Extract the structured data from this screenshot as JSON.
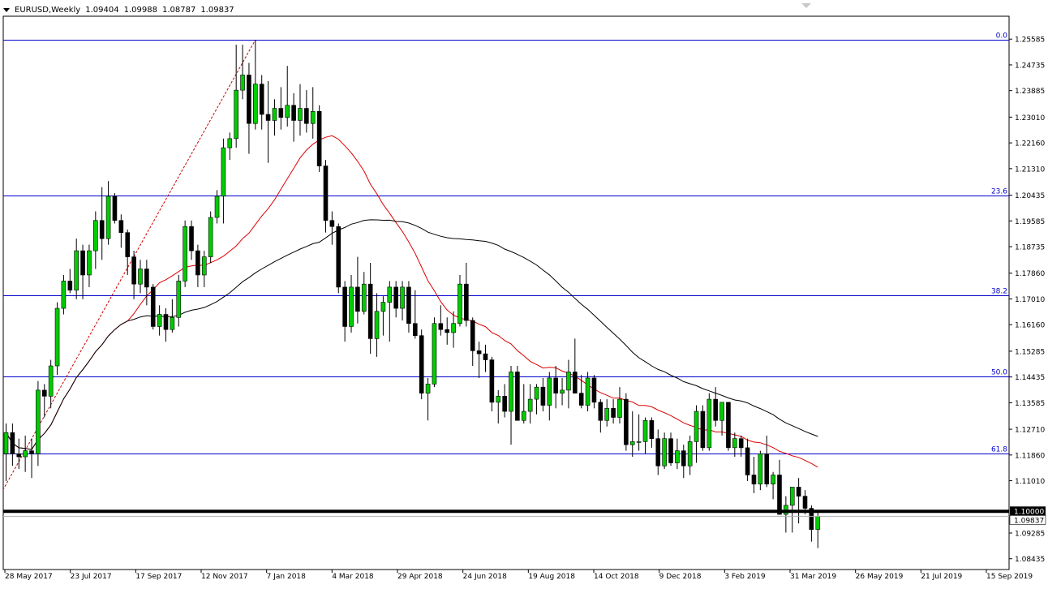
{
  "window": {
    "symbol": "EURUSD,Weekly",
    "ohlc": [
      "1.09404",
      "1.09988",
      "1.08787",
      "1.09837"
    ]
  },
  "chart_data": {
    "type": "candlestick",
    "ylim": [
      1.0808,
      1.2634
    ],
    "y_ticks": [
      "1.25585",
      "1.24735",
      "1.23885",
      "1.23010",
      "1.22160",
      "1.21310",
      "1.20435",
      "1.19585",
      "1.18735",
      "1.17860",
      "1.17010",
      "1.16160",
      "1.15285",
      "1.14435",
      "1.13585",
      "1.12710",
      "1.11860",
      "1.11010",
      "1.10000",
      "1.09285",
      "1.08435"
    ],
    "x_labels": [
      "28 May 2017",
      "23 Jul 2017",
      "17 Sep 2017",
      "12 Nov 2017",
      "7 Jan 2018",
      "4 Mar 2018",
      "29 Apr 2018",
      "24 Jun 2018",
      "19 Aug 2018",
      "14 Oct 2018",
      "9 Dec 2018",
      "3 Feb 2019",
      "31 Mar 2019",
      "26 May 2019",
      "21 Jul 2019",
      "15 Sep 2019"
    ],
    "fib_levels": [
      {
        "label": "0.0",
        "price": 1.2556
      },
      {
        "label": "23.6",
        "price": 1.2042
      },
      {
        "label": "38.2",
        "price": 1.1713
      },
      {
        "label": "50.0",
        "price": 1.1445
      },
      {
        "label": "61.8",
        "price": 1.119
      }
    ],
    "support_level": {
      "price": 1.1,
      "label": "1.10000"
    },
    "current_price": {
      "price": 1.09837,
      "label": "1.09837"
    },
    "candles": [
      [
        1.119,
        1.129,
        1.11,
        1.126
      ],
      [
        1.126,
        1.129,
        1.115,
        1.119
      ],
      [
        1.119,
        1.124,
        1.114,
        1.118
      ],
      [
        1.118,
        1.125,
        1.113,
        1.12
      ],
      [
        1.12,
        1.124,
        1.111,
        1.119
      ],
      [
        1.119,
        1.143,
        1.115,
        1.14
      ],
      [
        1.14,
        1.142,
        1.131,
        1.138
      ],
      [
        1.138,
        1.15,
        1.134,
        1.148
      ],
      [
        1.148,
        1.169,
        1.145,
        1.167
      ],
      [
        1.167,
        1.178,
        1.165,
        1.176
      ],
      [
        1.176,
        1.18,
        1.172,
        1.173
      ],
      [
        1.173,
        1.19,
        1.17,
        1.186
      ],
      [
        1.186,
        1.188,
        1.17,
        1.178
      ],
      [
        1.178,
        1.188,
        1.174,
        1.186
      ],
      [
        1.186,
        1.199,
        1.18,
        1.196
      ],
      [
        1.196,
        1.207,
        1.183,
        1.19
      ],
      [
        1.19,
        1.209,
        1.188,
        1.204
      ],
      [
        1.204,
        1.205,
        1.195,
        1.196
      ],
      [
        1.196,
        1.198,
        1.187,
        1.192
      ],
      [
        1.192,
        1.193,
        1.178,
        1.184
      ],
      [
        1.184,
        1.186,
        1.17,
        1.175
      ],
      [
        1.175,
        1.183,
        1.172,
        1.18
      ],
      [
        1.18,
        1.183,
        1.168,
        1.174
      ],
      [
        1.174,
        1.175,
        1.16,
        1.161
      ],
      [
        1.161,
        1.168,
        1.158,
        1.165
      ],
      [
        1.165,
        1.167,
        1.156,
        1.16
      ],
      [
        1.16,
        1.17,
        1.159,
        1.164
      ],
      [
        1.164,
        1.178,
        1.161,
        1.176
      ],
      [
        1.176,
        1.196,
        1.174,
        1.194
      ],
      [
        1.194,
        1.196,
        1.183,
        1.186
      ],
      [
        1.186,
        1.188,
        1.174,
        1.178
      ],
      [
        1.178,
        1.186,
        1.174,
        1.184
      ],
      [
        1.184,
        1.199,
        1.182,
        1.197
      ],
      [
        1.197,
        1.206,
        1.195,
        1.204
      ],
      [
        1.204,
        1.223,
        1.195,
        1.22
      ],
      [
        1.22,
        1.225,
        1.216,
        1.223
      ],
      [
        1.223,
        1.254,
        1.22,
        1.239
      ],
      [
        1.239,
        1.254,
        1.236,
        1.244
      ],
      [
        1.244,
        1.248,
        1.218,
        1.228
      ],
      [
        1.228,
        1.2556,
        1.226,
        1.241
      ],
      [
        1.241,
        1.244,
        1.226,
        1.231
      ],
      [
        1.231,
        1.242,
        1.215,
        1.229
      ],
      [
        1.229,
        1.236,
        1.224,
        1.233
      ],
      [
        1.233,
        1.24,
        1.226,
        1.23
      ],
      [
        1.23,
        1.247,
        1.227,
        1.234
      ],
      [
        1.234,
        1.238,
        1.222,
        1.229
      ],
      [
        1.229,
        1.241,
        1.224,
        1.233
      ],
      [
        1.233,
        1.239,
        1.225,
        1.228
      ],
      [
        1.228,
        1.24,
        1.223,
        1.232
      ],
      [
        1.232,
        1.234,
        1.212,
        1.214
      ],
      [
        1.214,
        1.216,
        1.192,
        1.196
      ],
      [
        1.196,
        1.199,
        1.188,
        1.194
      ],
      [
        1.194,
        1.195,
        1.172,
        1.174
      ],
      [
        1.174,
        1.176,
        1.156,
        1.161
      ],
      [
        1.161,
        1.178,
        1.159,
        1.174
      ],
      [
        1.174,
        1.184,
        1.162,
        1.166
      ],
      [
        1.166,
        1.179,
        1.165,
        1.175
      ],
      [
        1.175,
        1.182,
        1.152,
        1.157
      ],
      [
        1.157,
        1.172,
        1.151,
        1.166
      ],
      [
        1.166,
        1.171,
        1.158,
        1.169
      ],
      [
        1.169,
        1.176,
        1.156,
        1.174
      ],
      [
        1.174,
        1.176,
        1.164,
        1.167
      ],
      [
        1.167,
        1.176,
        1.163,
        1.174
      ],
      [
        1.174,
        1.176,
        1.159,
        1.162
      ],
      [
        1.162,
        1.173,
        1.157,
        1.158
      ],
      [
        1.158,
        1.16,
        1.137,
        1.139
      ],
      [
        1.139,
        1.144,
        1.13,
        1.142
      ],
      [
        1.142,
        1.164,
        1.141,
        1.162
      ],
      [
        1.162,
        1.168,
        1.158,
        1.16
      ],
      [
        1.16,
        1.164,
        1.155,
        1.159
      ],
      [
        1.159,
        1.166,
        1.154,
        1.162
      ],
      [
        1.162,
        1.178,
        1.161,
        1.175
      ],
      [
        1.175,
        1.182,
        1.161,
        1.163
      ],
      [
        1.163,
        1.164,
        1.148,
        1.153
      ],
      [
        1.153,
        1.156,
        1.144,
        1.152
      ],
      [
        1.152,
        1.155,
        1.146,
        1.15
      ],
      [
        1.15,
        1.151,
        1.133,
        1.136
      ],
      [
        1.136,
        1.14,
        1.129,
        1.138
      ],
      [
        1.138,
        1.142,
        1.131,
        1.133
      ],
      [
        1.133,
        1.148,
        1.122,
        1.146
      ],
      [
        1.146,
        1.148,
        1.132,
        1.13
      ],
      [
        1.13,
        1.142,
        1.129,
        1.133
      ],
      [
        1.133,
        1.142,
        1.129,
        1.137
      ],
      [
        1.137,
        1.142,
        1.132,
        1.141
      ],
      [
        1.141,
        1.144,
        1.133,
        1.135
      ],
      [
        1.135,
        1.146,
        1.13,
        1.144
      ],
      [
        1.144,
        1.148,
        1.134,
        1.139
      ],
      [
        1.139,
        1.144,
        1.135,
        1.14
      ],
      [
        1.14,
        1.15,
        1.134,
        1.146
      ],
      [
        1.146,
        1.157,
        1.139,
        1.139
      ],
      [
        1.139,
        1.145,
        1.134,
        1.135
      ],
      [
        1.135,
        1.146,
        1.133,
        1.144
      ],
      [
        1.144,
        1.145,
        1.134,
        1.136
      ],
      [
        1.136,
        1.137,
        1.126,
        1.13
      ],
      [
        1.13,
        1.137,
        1.128,
        1.134
      ],
      [
        1.134,
        1.137,
        1.129,
        1.131
      ],
      [
        1.131,
        1.141,
        1.129,
        1.137
      ],
      [
        1.137,
        1.139,
        1.12,
        1.122
      ],
      [
        1.122,
        1.133,
        1.118,
        1.123
      ],
      [
        1.123,
        1.132,
        1.12,
        1.123
      ],
      [
        1.123,
        1.131,
        1.119,
        1.13
      ],
      [
        1.13,
        1.131,
        1.121,
        1.124
      ],
      [
        1.124,
        1.127,
        1.112,
        1.115
      ],
      [
        1.115,
        1.126,
        1.114,
        1.124
      ],
      [
        1.124,
        1.126,
        1.115,
        1.116
      ],
      [
        1.116,
        1.124,
        1.114,
        1.12
      ],
      [
        1.12,
        1.122,
        1.111,
        1.115
      ],
      [
        1.115,
        1.125,
        1.112,
        1.123
      ],
      [
        1.123,
        1.135,
        1.116,
        1.133
      ],
      [
        1.133,
        1.135,
        1.12,
        1.121
      ],
      [
        1.121,
        1.139,
        1.12,
        1.137
      ],
      [
        1.137,
        1.141,
        1.128,
        1.13
      ],
      [
        1.13,
        1.136,
        1.125,
        1.136
      ],
      [
        1.136,
        1.136,
        1.12,
        1.121
      ],
      [
        1.121,
        1.126,
        1.118,
        1.124
      ],
      [
        1.124,
        1.125,
        1.118,
        1.121
      ],
      [
        1.121,
        1.124,
        1.11,
        1.112
      ],
      [
        1.112,
        1.118,
        1.106,
        1.109
      ],
      [
        1.109,
        1.12,
        1.107,
        1.119
      ],
      [
        1.119,
        1.125,
        1.108,
        1.109
      ],
      [
        1.109,
        1.113,
        1.104,
        1.112
      ],
      [
        1.112,
        1.117,
        1.1,
        1.099
      ],
      [
        1.099,
        1.105,
        1.093,
        1.102
      ],
      [
        1.102,
        1.108,
        1.093,
        1.108
      ],
      [
        1.108,
        1.111,
        1.096,
        1.105
      ],
      [
        1.105,
        1.107,
        1.099,
        1.101
      ],
      [
        1.101,
        1.102,
        1.09,
        1.094
      ],
      [
        1.09404,
        1.09988,
        1.08787,
        1.09837
      ]
    ]
  }
}
